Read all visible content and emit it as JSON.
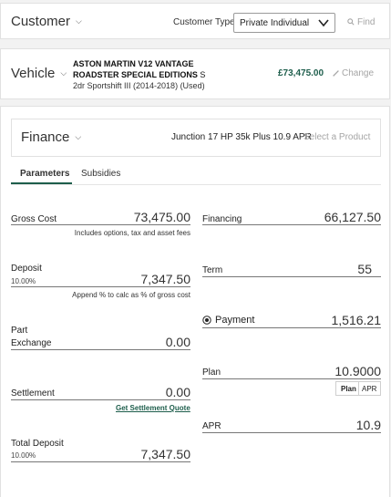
{
  "customer": {
    "title": "Customer",
    "type_label": "Customer Type",
    "type_value": "Private Individual",
    "find_label": "Find"
  },
  "vehicle": {
    "title": "Vehicle",
    "name_bold": "ASTON MARTIN V12 VANTAGE ROADSTER SPECIAL EDITIONS",
    "name_suffix": "S",
    "spec": "2dr Sportshift III (2014-2018) (Used)",
    "price": "£73,475.00",
    "change_label": "Change"
  },
  "finance": {
    "title": "Finance",
    "product_name": "Junction 17 HP 35k Plus 10.9 APR",
    "select_product_label": "Select a Product",
    "tabs": [
      "Parameters",
      "Subsidies"
    ],
    "active_tab": "Parameters",
    "gross_cost": {
      "label": "Gross Cost",
      "value": "73,475.00",
      "hint": "Includes options, tax and asset fees"
    },
    "deposit": {
      "label": "Deposit",
      "percent": "10.00%",
      "value": "7,347.50",
      "hint": "Append % to calc as % of gross cost"
    },
    "part_exchange": {
      "label_line1": "Part",
      "label_line2": "Exchange",
      "value": "0.00"
    },
    "settlement": {
      "label": "Settlement",
      "value": "0.00",
      "link": "Get Settlement Quote"
    },
    "total_deposit": {
      "label": "Total Deposit",
      "percent": "10.00%",
      "value": "7,347.50"
    },
    "financing": {
      "label": "Financing",
      "value": "66,127.50"
    },
    "term": {
      "label": "Term",
      "value": "55"
    },
    "payment": {
      "label": "Payment",
      "value": "1,516.21"
    },
    "plan": {
      "label": "Plan",
      "value": "10.9000",
      "toggle_options": [
        "Plan",
        "APR"
      ],
      "toggle_selected": "Plan"
    },
    "apr": {
      "label": "APR",
      "value": "10.9"
    }
  },
  "colors": {
    "accent": "#1e5e4c",
    "muted": "#a5a5a5",
    "background": "#f2f2f2"
  }
}
